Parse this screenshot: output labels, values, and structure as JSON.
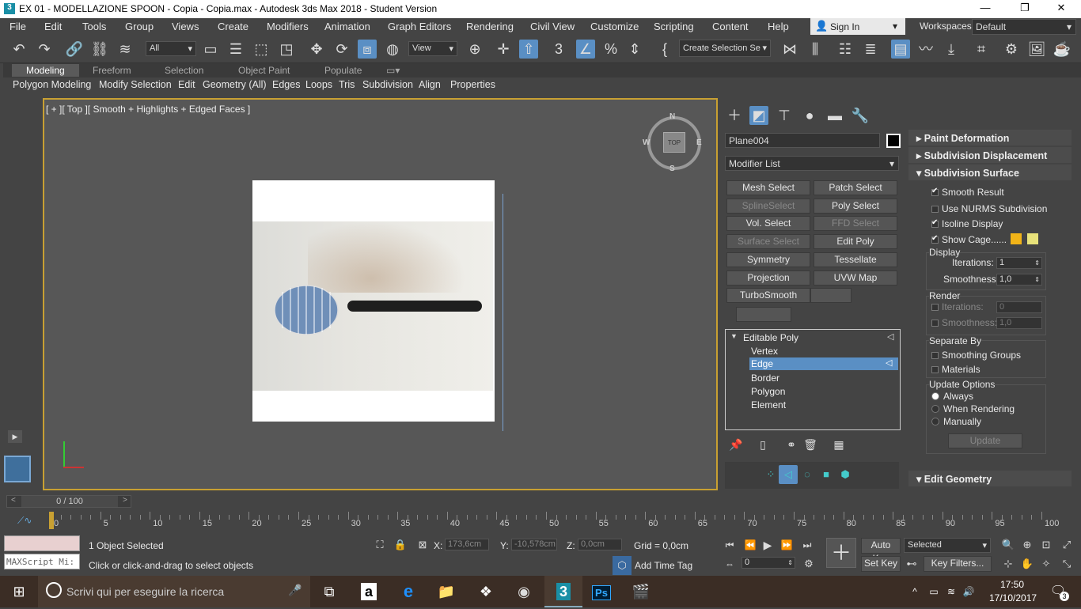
{
  "window": {
    "title": "EX 01 - MODELLAZIONE SPOON - Copia - Copia.max - Autodesk 3ds Max 2018 - Student Version"
  },
  "menu": [
    "File",
    "Edit",
    "Tools",
    "Group",
    "Views",
    "Create",
    "Modifiers",
    "Animation",
    "Graph Editors",
    "Rendering",
    "Civil View",
    "Customize",
    "Scripting",
    "Content",
    "Help"
  ],
  "signin": "Sign In",
  "workspaces": {
    "label": "Workspaces:",
    "value": "Default"
  },
  "toolbar": {
    "filter": "All",
    "refcoord": "View",
    "selset": "Create Selection Se"
  },
  "ribbon": {
    "tabs": [
      "Modeling",
      "Freeform",
      "Selection",
      "Object Paint",
      "Populate"
    ],
    "buttons": [
      "Polygon Modeling",
      "Modify Selection",
      "Edit",
      "Geometry (All)",
      "Edges",
      "Loops",
      "Tris",
      "Subdivision",
      "Align",
      "Properties"
    ]
  },
  "viewport": {
    "label": "[ + ][ Top ][ Smooth + Highlights + Edged Faces ]",
    "cube": {
      "top": "TOP",
      "n": "N",
      "s": "S",
      "e": "E",
      "w": "W"
    }
  },
  "command_panel": {
    "object_name": "Plane004",
    "modifier_list": "Modifier List",
    "modifiers": [
      [
        "Mesh Select",
        "Patch Select"
      ],
      [
        "SplineSelect",
        "Poly Select"
      ],
      [
        "Vol. Select",
        "FFD Select"
      ],
      [
        "Surface Select",
        "Edit Poly"
      ],
      [
        "Symmetry",
        "Tessellate"
      ],
      [
        "Projection",
        "UVW Map"
      ],
      [
        "TurboSmooth",
        ""
      ]
    ],
    "stack": {
      "root": "Editable Poly",
      "items": [
        "Vertex",
        "Edge",
        "Border",
        "Polygon",
        "Element"
      ],
      "selected": "Edge"
    }
  },
  "rollouts": {
    "paint_deformation": "Paint Deformation",
    "subdivision_displacement": "Subdivision Displacement",
    "subdivision_surface": "Subdivision Surface",
    "smooth_result": "Smooth Result",
    "use_nurms": "Use NURMS Subdivision",
    "isoline": "Isoline Display",
    "show_cage": "Show Cage......",
    "display": "Display",
    "iterations_label": "Iterations:",
    "iterations_value": "1",
    "smoothness_label": "Smoothness:",
    "smoothness_value": "1,0",
    "render": "Render",
    "r_iterations_value": "0",
    "r_smoothness_value": "1,0",
    "separate_by": "Separate By",
    "smoothing_groups": "Smoothing Groups",
    "materials": "Materials",
    "update_options": "Update Options",
    "always": "Always",
    "when_rendering": "When Rendering",
    "manually": "Manually",
    "update": "Update",
    "edit_geometry": "Edit Geometry",
    "cage_colors": [
      "#f2b418",
      "#e8e27a"
    ]
  },
  "timeline": {
    "frame": "0 / 100",
    "ticks": [
      "0",
      "5",
      "10",
      "15",
      "20",
      "25",
      "30",
      "35",
      "40",
      "45",
      "50",
      "55",
      "60",
      "65",
      "70",
      "75",
      "80",
      "85",
      "90",
      "95",
      "100"
    ]
  },
  "status": {
    "maxscript": "MAXScript Mi:",
    "selected": "1 Object Selected",
    "prompt": "Click or click-and-drag to select objects",
    "x_label": "X:",
    "x": "173,6cm",
    "y_label": "Y:",
    "y": "-10,578cm",
    "z_label": "Z:",
    "z": "0,0cm",
    "grid": "Grid = 0,0cm",
    "add_time_tag": "Add Time Tag",
    "auto_key": "Auto Key",
    "set_key": "Set Key",
    "key_mode": "Selected",
    "key_filters": "Key Filters...",
    "frame": "0"
  },
  "taskbar": {
    "search": "Scrivi qui per eseguire la ricerca",
    "time": "17:50",
    "date": "17/10/2017",
    "notif": "3"
  }
}
